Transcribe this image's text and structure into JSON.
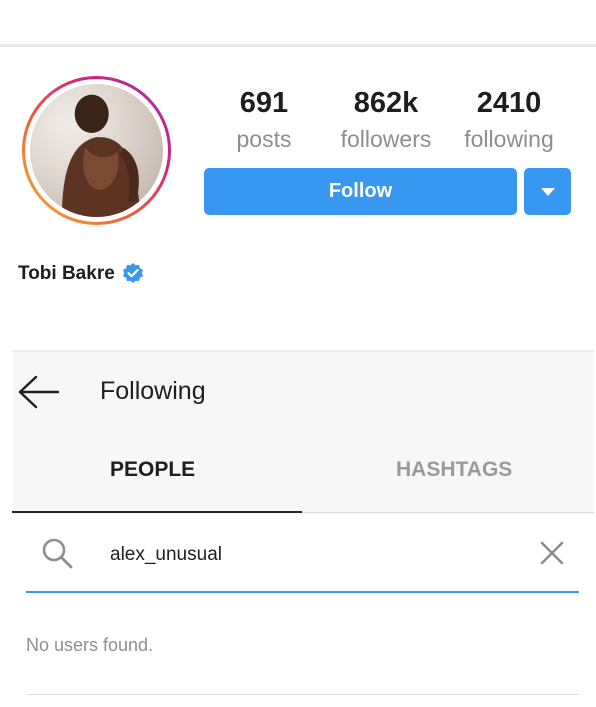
{
  "profile": {
    "name": "Tobi Bakre",
    "verified": true,
    "stats": {
      "posts": {
        "count": "691",
        "label": "posts"
      },
      "followers": {
        "count": "862k",
        "label": "followers"
      },
      "following": {
        "count": "2410",
        "label": "following"
      }
    },
    "follow_label": "Follow"
  },
  "following_panel": {
    "title": "Following",
    "tabs": [
      {
        "label": "PEOPLE",
        "active": true
      },
      {
        "label": "HASHTAGS",
        "active": false
      }
    ],
    "search": {
      "value": "alex_unusual"
    },
    "empty_message": "No users found."
  },
  "icons": {
    "back": "arrow-left-icon",
    "search": "search-icon",
    "clear": "close-icon",
    "dropdown": "chevron-down-icon",
    "verified": "verified-badge-icon"
  },
  "colors": {
    "accent": "#3897f0",
    "text_primary": "#1e1e1e",
    "text_secondary": "#8e8e8e",
    "verified": "#3897f0"
  }
}
